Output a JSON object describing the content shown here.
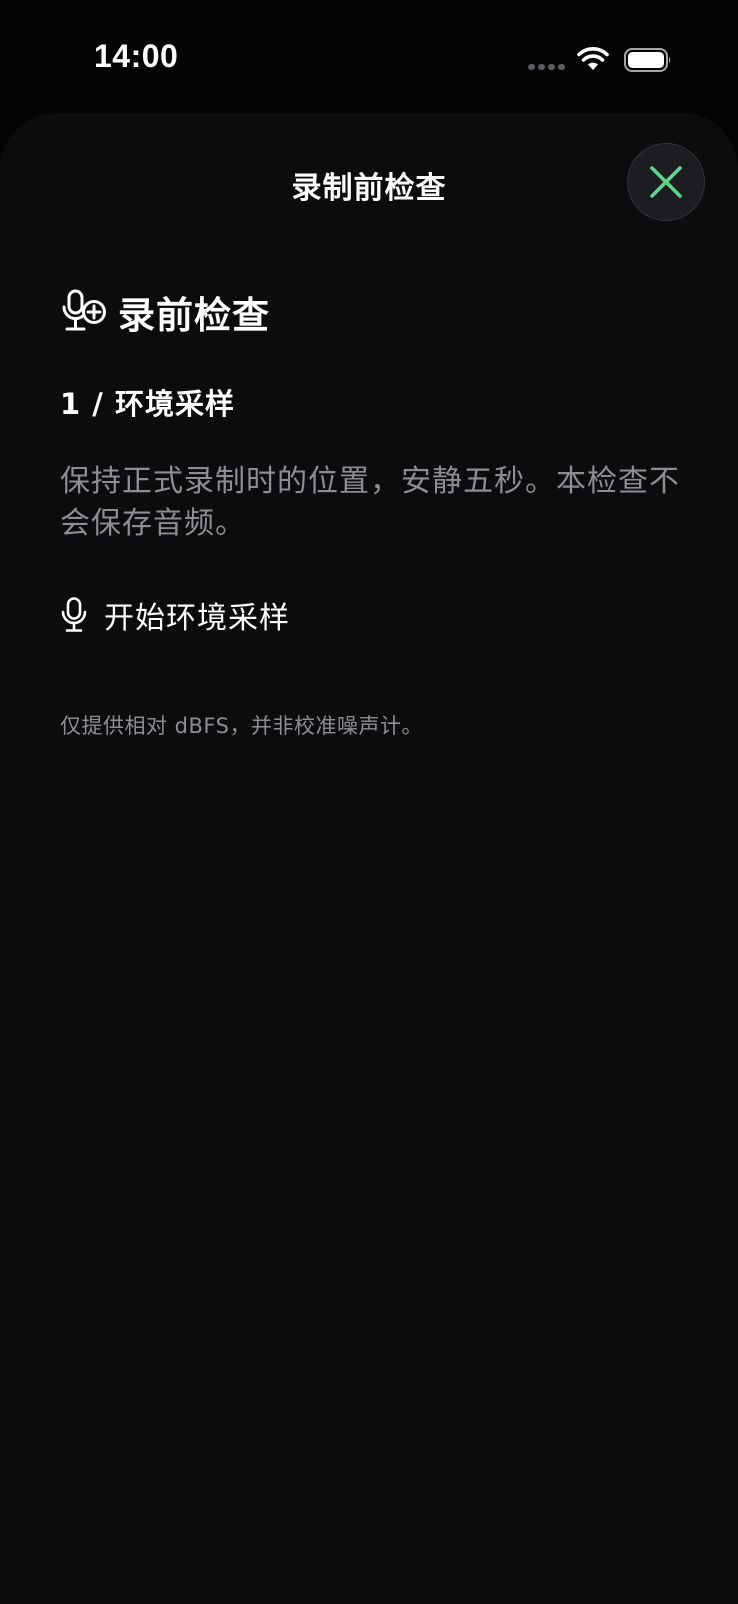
{
  "status_bar": {
    "time": "14:00",
    "icons": [
      "cellular-signal-icon",
      "wifi-icon",
      "battery-icon"
    ]
  },
  "sheet": {
    "title": "录制前检查",
    "close_icon": "close-x-icon",
    "section": {
      "icon": "mic-plus-icon",
      "heading": "录前检查"
    },
    "step": {
      "label": "1 / 环境采样",
      "description": "保持正式录制时的位置，安静五秒。本检查不会保存音频。"
    },
    "action": {
      "icon": "microphone-icon",
      "label": "开始环境采样"
    },
    "footnote": "仅提供相对 dBFS，并非校准噪声计。"
  },
  "colors": {
    "background": "#040405",
    "sheet": "#0b0c0e",
    "accent_green": "#5fd38d",
    "secondary_text": "#8d8e93",
    "close_button_bg": "#1c1d20"
  }
}
